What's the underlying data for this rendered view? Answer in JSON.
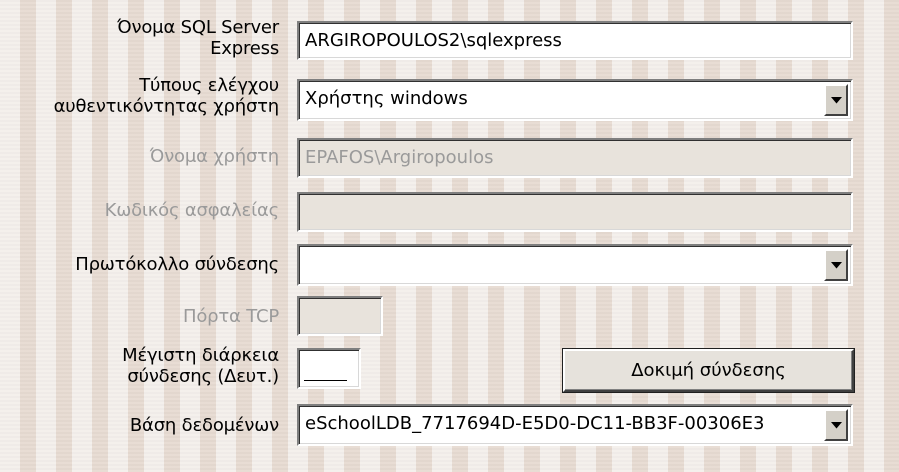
{
  "fields": {
    "server_name": {
      "label_line1": "Όνομα SQL Server",
      "label_line2": "Express",
      "value": "ARGIROPOULOS2\\sqlexpress"
    },
    "auth_type": {
      "label_line1": "Τύπους ελέγχου",
      "label_line2": "αυθεντικόντητας χρήστη",
      "value": "Χρήστης windows"
    },
    "username": {
      "label": "Όνομα χρήστη",
      "value": "EPAFOS\\Argiropoulos"
    },
    "password": {
      "label": "Κωδικός ασφαλείας",
      "value": ""
    },
    "protocol": {
      "label": "Πρωτόκολλο σύνδεσης",
      "value": ""
    },
    "tcp_port": {
      "label": "Πόρτα TCP",
      "value": ""
    },
    "timeout": {
      "label_line1": "Μέγιστη διάρκεια",
      "label_line2": "σύνδεσης (Δευτ.)",
      "value": ""
    },
    "database": {
      "label": "Βάση δεδομένων",
      "value": "eSchoolLDB_7717694D-E5D0-DC11-BB3F-00306E3"
    }
  },
  "buttons": {
    "test_connection": "Δοκιμή σύνδεσης"
  },
  "icons": {
    "dropdown": "chevron-down-icon"
  }
}
